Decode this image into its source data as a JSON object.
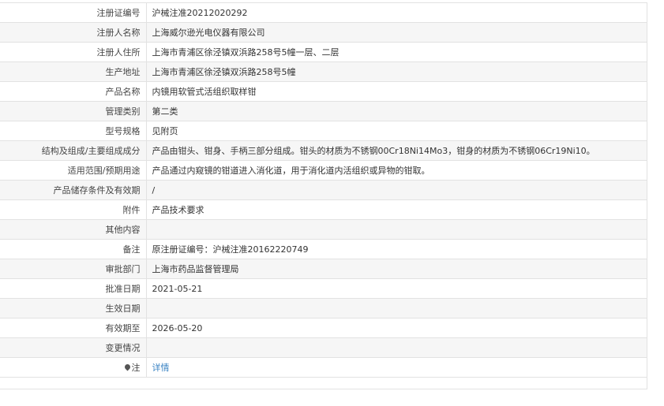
{
  "rows": [
    {
      "label": "注册证编号",
      "value": "沪械注准20212020292"
    },
    {
      "label": "注册人名称",
      "value": "上海威尔逊光电仪器有限公司"
    },
    {
      "label": "注册人住所",
      "value": "上海市青浦区徐泾镇双浜路258号5幢一层、二层"
    },
    {
      "label": "生产地址",
      "value": "上海市青浦区徐泾镇双浜路258号5幢"
    },
    {
      "label": "产品名称",
      "value": "内镜用软管式活组织取样钳"
    },
    {
      "label": "管理类别",
      "value": "第二类"
    },
    {
      "label": "型号规格",
      "value": "见附页"
    },
    {
      "label": "结构及组成/主要组成成分",
      "value": "产品由钳头、钳身、手柄三部分组成。钳头的材质为不锈钢00Cr18Ni14Mo3，钳身的材质为不锈钢06Cr19Ni10。"
    },
    {
      "label": "适用范围/预期用途",
      "value": "产品通过内窥镜的钳道进入消化道，用于消化道内活组织或异物的钳取。"
    },
    {
      "label": "产品储存条件及有效期",
      "value": "/"
    },
    {
      "label": "附件",
      "value": "产品技术要求"
    },
    {
      "label": "其他内容",
      "value": ""
    },
    {
      "label": "备注",
      "value": "原注册证编号：沪械注准20162220749"
    },
    {
      "label": "审批部门",
      "value": "上海市药品监督管理局"
    },
    {
      "label": "批准日期",
      "value": "2021-05-21"
    },
    {
      "label": "生效日期",
      "value": ""
    },
    {
      "label": "有效期至",
      "value": "2026-05-20"
    },
    {
      "label": "变更情况",
      "value": ""
    }
  ],
  "note": {
    "label": "注",
    "link_text": "详情"
  }
}
